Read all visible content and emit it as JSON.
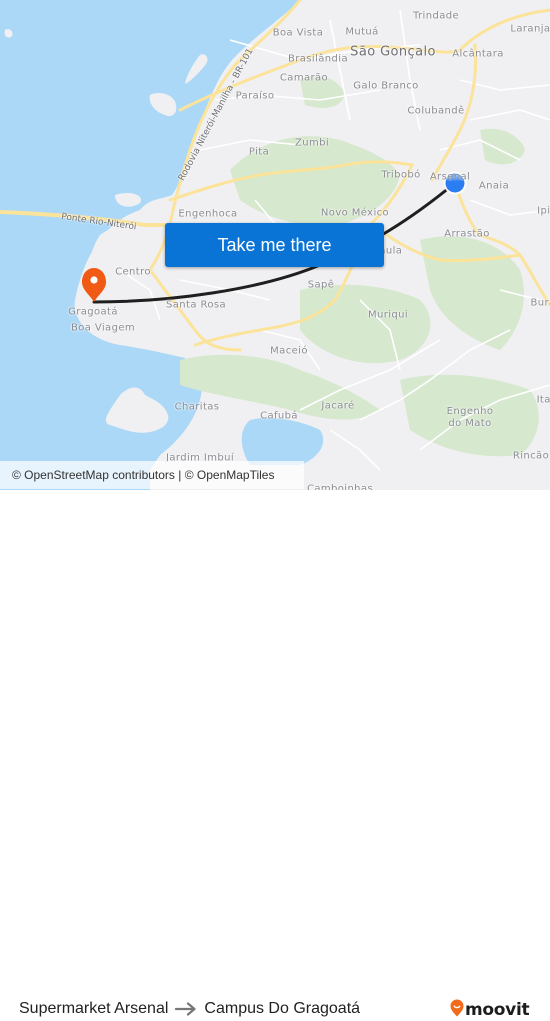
{
  "map": {
    "colors": {
      "water": "#abd8f7",
      "land": "#f0f0f2",
      "forest": "#d6e8cd",
      "major_road": "#fbe39a",
      "minor_road": "#ffffff",
      "route_line": "#1f1f1f",
      "origin_marker": "#2b7df2",
      "destination_marker": "#f05a14"
    },
    "places": [
      {
        "name": "Trindade"
      },
      {
        "name": "Laranjal"
      },
      {
        "name": "Boa Vista"
      },
      {
        "name": "Mutuá"
      },
      {
        "name": "São Gonçalo"
      },
      {
        "name": "Alcântara"
      },
      {
        "name": "Brasilândia"
      },
      {
        "name": "Camarão"
      },
      {
        "name": "Paraíso"
      },
      {
        "name": "Galo Branco"
      },
      {
        "name": "Colubandê"
      },
      {
        "name": "Pita"
      },
      {
        "name": "Zumbi"
      },
      {
        "name": "Tribobó"
      },
      {
        "name": "Arsenal"
      },
      {
        "name": "Anaia"
      },
      {
        "name": "Engenhoca"
      },
      {
        "name": "Novo México"
      },
      {
        "name": "Ipiíba"
      },
      {
        "name": "Arrastão"
      },
      {
        "name": "Centro"
      },
      {
        "name": "Pitaula"
      },
      {
        "name": "Sapê"
      },
      {
        "name": "Santa Rosa"
      },
      {
        "name": "Gragoatá"
      },
      {
        "name": "Boa Viagem"
      },
      {
        "name": "Muriqui"
      },
      {
        "name": "Buracos"
      },
      {
        "name": "Maceió"
      },
      {
        "name": "Charitas"
      },
      {
        "name": "Jacaré"
      },
      {
        "name": "Cafubá"
      },
      {
        "name": "Engenho do Mato"
      },
      {
        "name": "Itaipu"
      },
      {
        "name": "Jardim Imbuí"
      },
      {
        "name": "Rincão"
      },
      {
        "name": "Camboinhas"
      }
    ],
    "roads": [
      {
        "name": "Rodovia Niterói-Manilha - BR-101"
      },
      {
        "name": "Ponte Rio-Niterói"
      }
    ],
    "origin_marker": {
      "label": "Supermarket Arsenal",
      "icon": "current-location-dot-icon"
    },
    "destination_marker": {
      "label": "Campus Do Gragoatá",
      "icon": "map-pin-icon"
    },
    "cta_button": {
      "label": "Take me there"
    },
    "attribution": "© OpenStreetMap contributors | © OpenMapTiles"
  },
  "footer": {
    "origin": "Supermarket Arsenal",
    "arrow_icon": "arrow-right-icon",
    "destination": "Campus Do Gragoatá",
    "brand": {
      "name": "moovit",
      "icon": "moovit-pin-logo-icon",
      "color": "#f26a1b"
    }
  }
}
